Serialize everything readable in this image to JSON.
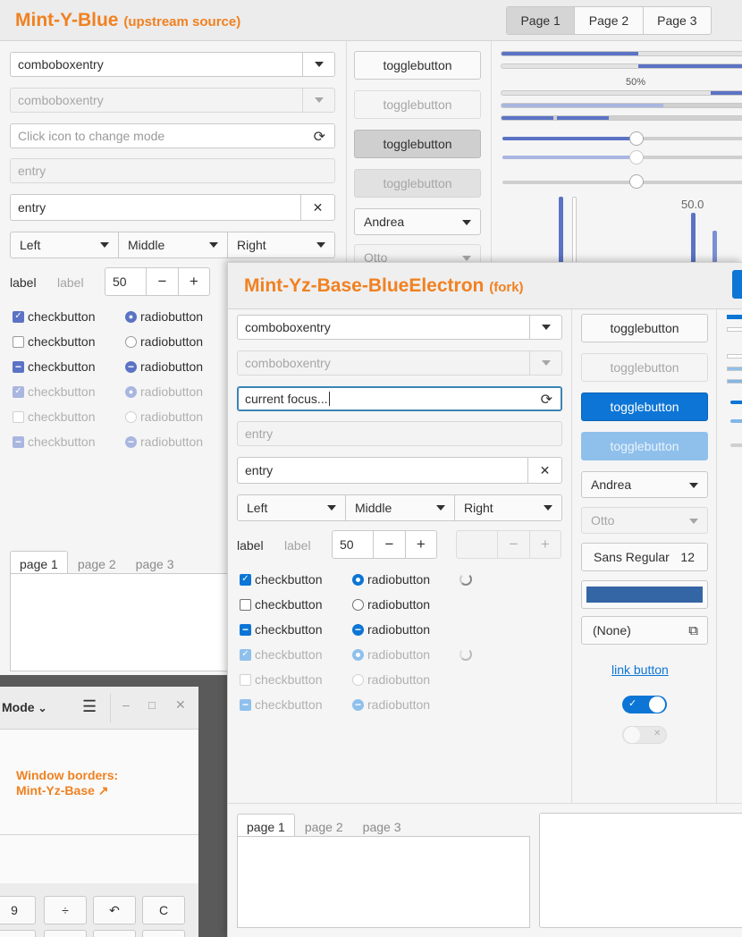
{
  "colors": {
    "accent_orange": "#f08121",
    "mint_blue": "#5b73c4",
    "electron_blue": "#0c75d5"
  },
  "w1": {
    "title": "Mint-Y-Blue",
    "title_note": "(upstream source)",
    "header_tabs": [
      "Page 1",
      "Page 2",
      "Page 3"
    ],
    "combo_entry": "comboboxentry",
    "combo_entry_disabled": "comboboxentry",
    "icon_entry_placeholder": "Click icon to change mode",
    "entry_disabled_placeholder": "entry",
    "entry_value": "entry",
    "seg": [
      "Left",
      "Middle",
      "Right"
    ],
    "label": "label",
    "label_dim": "label",
    "spin_value": "50",
    "check_label": "checkbutton",
    "radio_label": "radiobutton",
    "toggle": "togglebutton",
    "combo_andrea": "Andrea",
    "combo_otto": "Otto",
    "progress_text": "50%",
    "scale_value": "50.0",
    "notebook_tabs": [
      "page 1",
      "page 2",
      "page 3"
    ]
  },
  "w2": {
    "title": "Mint-Yz-Base-BlueElectron",
    "title_note": "(fork)",
    "combo_entry": "comboboxentry",
    "combo_entry_disabled": "comboboxentry",
    "focus_entry_value": "current focus...",
    "entry_disabled_placeholder": "entry",
    "entry_value": "entry",
    "seg": [
      "Left",
      "Middle",
      "Right"
    ],
    "label": "label",
    "label_dim": "label",
    "spin_value": "50",
    "check_label": "checkbutton",
    "radio_label": "radiobutton",
    "toggle": "togglebutton",
    "combo_andrea": "Andrea",
    "combo_otto": "Otto",
    "font_name": "Sans Regular",
    "font_size": "12",
    "file_chooser": "(None)",
    "link": "link button",
    "notebook_tabs": [
      "page 1",
      "page 2",
      "page 3"
    ]
  },
  "w3": {
    "mode": "Mode",
    "note_line1": "Window borders:",
    "note_line2": "Mint-Yz-Base ↗",
    "keys": [
      "9",
      "÷",
      "↶",
      "C"
    ]
  }
}
